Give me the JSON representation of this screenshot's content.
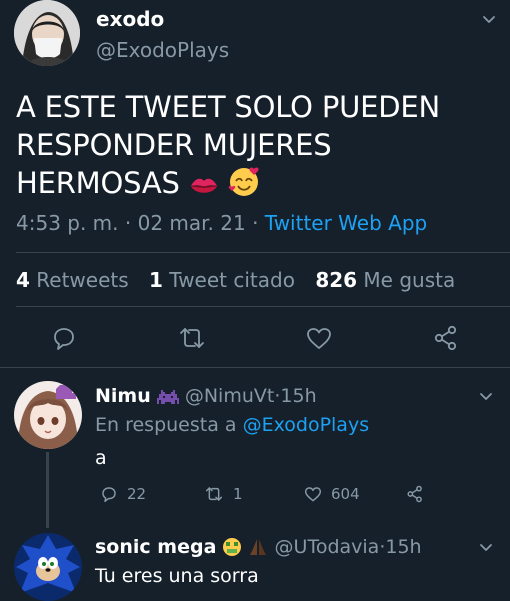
{
  "main_tweet": {
    "name": "exodo",
    "handle": "@ExodoPlays",
    "text_line1": "A ESTE TWEET SOLO PUEDEN",
    "text_line2": "RESPONDER MUJERES",
    "text_line3": "HERMOSAS",
    "emojis": [
      "kiss-mark-emoji",
      "smiling-face-with-hearts-emoji"
    ],
    "time": "4:53 p. m.",
    "date": "02 mar. 21",
    "source": "Twitter Web App",
    "sep": "·",
    "stats": {
      "retweets_count": "4",
      "retweets_label": "Retweets",
      "quotes_count": "1",
      "quotes_label": "Tweet citado",
      "likes_count": "826",
      "likes_label": "Me gusta"
    },
    "actions": [
      "reply-icon",
      "retweet-icon",
      "like-icon",
      "share-icon"
    ]
  },
  "replies": [
    {
      "name": "Nimu",
      "name_emoji": "space-invader-emoji",
      "handle": "@NimuVt",
      "time": "15h",
      "in_reply_prefix": "En respuesta a",
      "in_reply_handle": "@ExodoPlays",
      "text": "a",
      "reply_count": "22",
      "retweet_count": "1",
      "like_count": "604"
    },
    {
      "name": "sonic mega",
      "name_emoji": "money-mouth-face-emoji, folded-hands-emoji",
      "handle": "@UTodavia",
      "time": "15h",
      "text": "Tu eres una sorra"
    }
  ],
  "colors": {
    "background": "#15202b",
    "muted": "#8899a6",
    "accent": "#1da1f2",
    "divider": "#38444d"
  }
}
